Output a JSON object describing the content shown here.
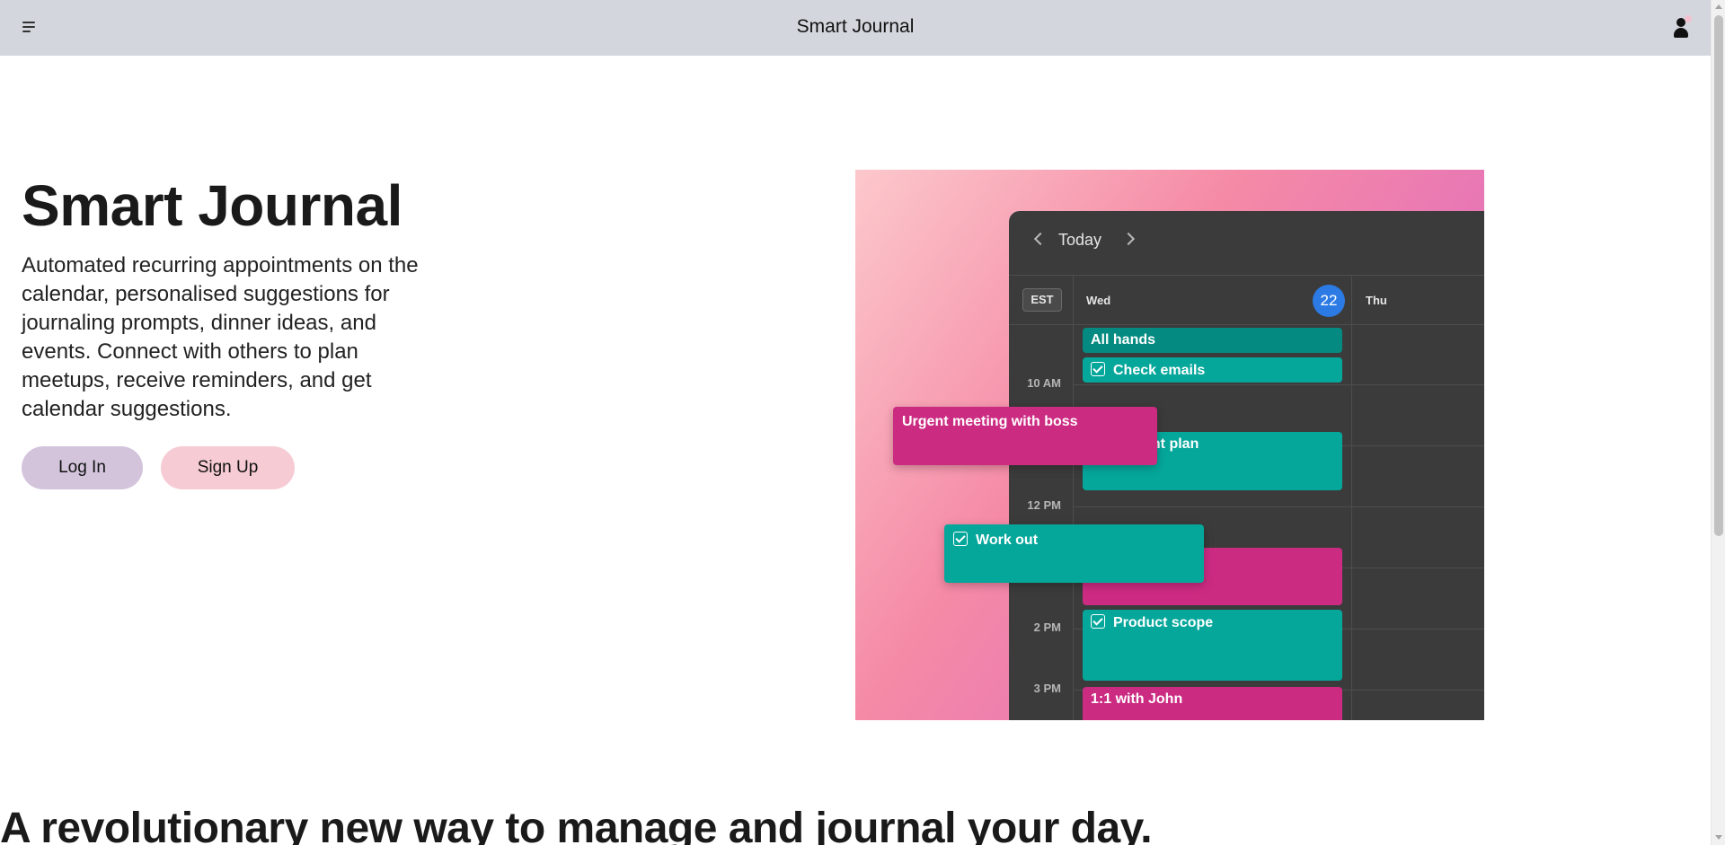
{
  "header": {
    "title": "Smart Journal",
    "menu_icon": "menu-icon",
    "user_icon": "user-icon"
  },
  "hero": {
    "title": "Smart Journal",
    "description": "Automated recurring appointments on the calendar, personalised suggestions for journaling prompts, dinner ideas, and events. Connect with others to plan meetups, receive reminders, and get calendar suggestions.",
    "login_label": "Log In",
    "signup_label": "Sign Up"
  },
  "calendar": {
    "today_label": "Today",
    "timezone": "EST",
    "day1": "Wed",
    "day1_date": "22",
    "day2": "Thu",
    "time_labels": [
      "10 AM",
      "12 PM",
      "2 PM",
      "3 PM"
    ],
    "events": {
      "all_hands": "All hands",
      "check_emails": "Check emails",
      "plan": "ent plan",
      "product_scope": "Product scope",
      "one_on_one": "1:1 with John"
    },
    "floating": {
      "urgent": "Urgent meeting with boss",
      "workout": "Work out"
    }
  },
  "section": {
    "title": "A revolutionary new way to manage and journal your day."
  }
}
